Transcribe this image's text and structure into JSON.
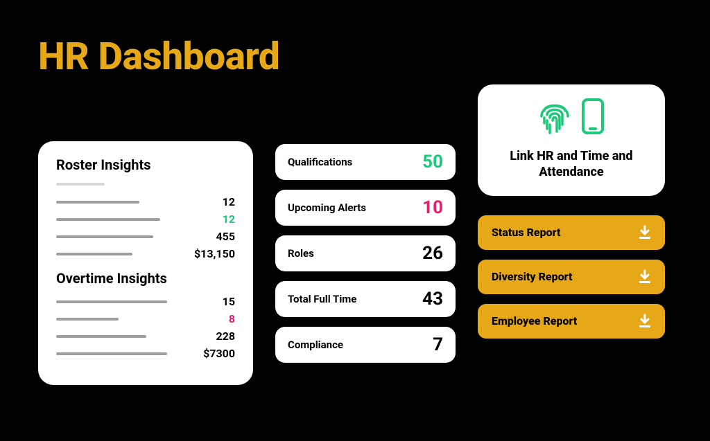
{
  "title": "HR Dashboard",
  "colors": {
    "accent": "#E6A817",
    "green": "#1fc77a",
    "pink": "#e61e6e"
  },
  "roster": {
    "heading": "Roster Insights",
    "rows": [
      {
        "value": "12",
        "color": "black"
      },
      {
        "value": "12",
        "color": "green"
      },
      {
        "value": "455",
        "color": "black"
      },
      {
        "value": "$13,150",
        "color": "black"
      }
    ]
  },
  "overtime": {
    "heading": "Overtime Insights",
    "rows": [
      {
        "value": "15",
        "color": "black"
      },
      {
        "value": "8",
        "color": "pink"
      },
      {
        "value": "228",
        "color": "black"
      },
      {
        "value": "$7300",
        "color": "black"
      }
    ]
  },
  "stats": [
    {
      "label": "Qualifications",
      "value": "50",
      "color": "green"
    },
    {
      "label": "Upcoming Alerts",
      "value": "10",
      "color": "pink"
    },
    {
      "label": "Roles",
      "value": "26",
      "color": "black"
    },
    {
      "label": "Total Full Time",
      "value": "43",
      "color": "black"
    },
    {
      "label": "Compliance",
      "value": "7",
      "color": "black"
    }
  ],
  "link_card": {
    "title": "Link HR and Time and Attendance",
    "icons": [
      "fingerprint-icon",
      "phone-icon"
    ]
  },
  "reports": [
    {
      "label": "Status Report"
    },
    {
      "label": "Diversity Report"
    },
    {
      "label": "Employee Report"
    }
  ]
}
